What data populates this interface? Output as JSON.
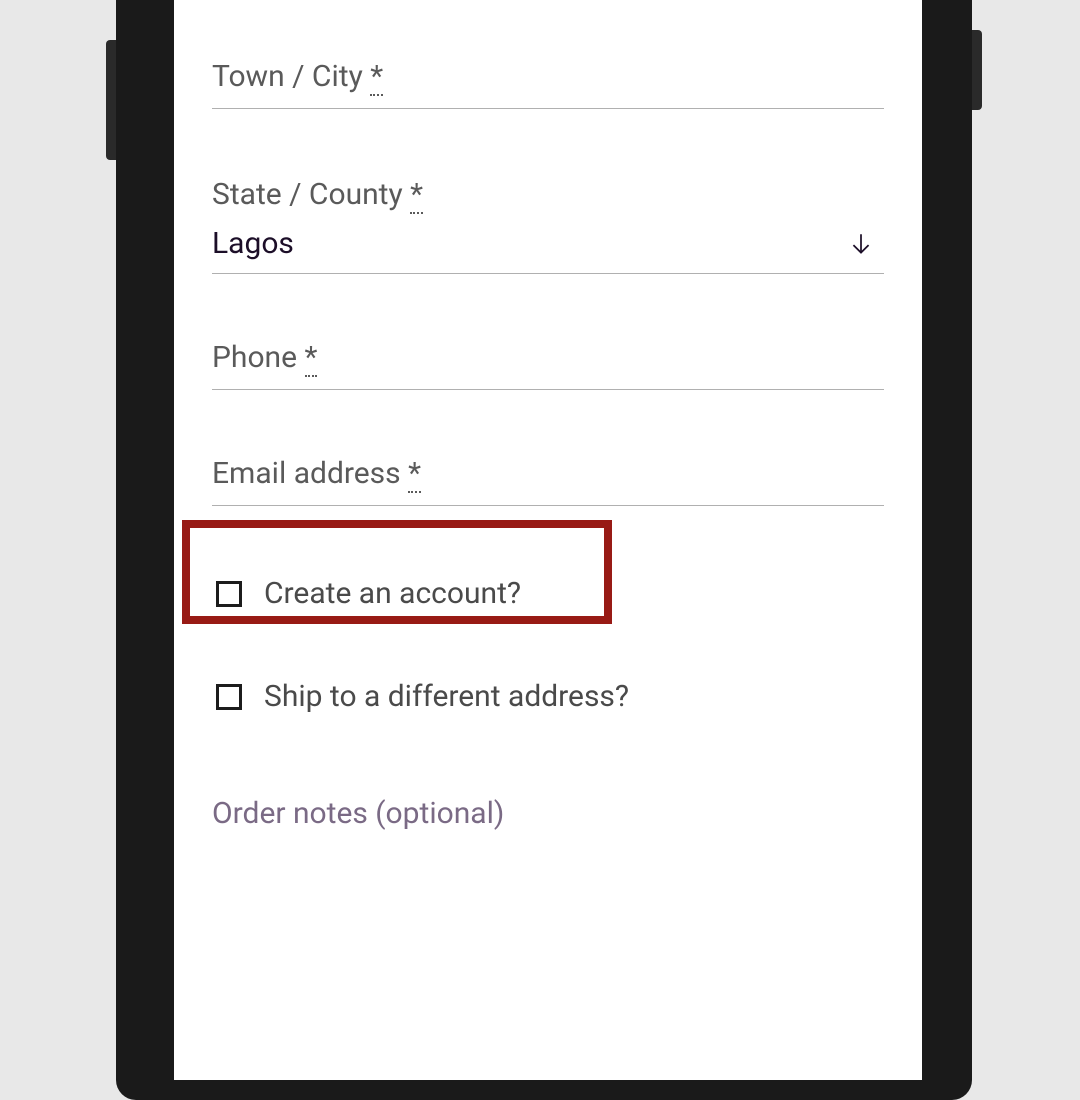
{
  "fields": {
    "town": {
      "label": "Town / City",
      "required": "*"
    },
    "state": {
      "label": "State / County",
      "required": "*",
      "value": "Lagos"
    },
    "phone": {
      "label": "Phone",
      "required": "*"
    },
    "email": {
      "label": "Email address",
      "required": "*"
    }
  },
  "checks": {
    "create_account": {
      "label": "Create an account?"
    },
    "ship_different": {
      "label": "Ship to a different address?"
    }
  },
  "notes": {
    "label": "Order notes (optional)"
  }
}
